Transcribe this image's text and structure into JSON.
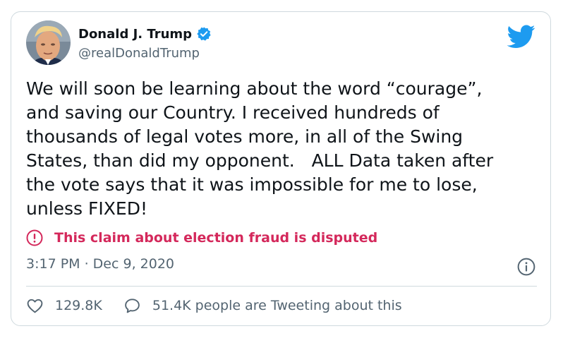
{
  "author": {
    "display_name": "Donald J. Trump",
    "handle": "@realDonaldTrump",
    "verified": true
  },
  "tweet": {
    "text": "We will soon be learning about the word “courage”,\nand saving our Country. I received hundreds of\nthousands of legal votes more, in all of the Swing\nStates, than did my opponent.   ALL Data taken after\nthe vote says that it was impossible for me to lose,\nunless FIXED!",
    "label": "This claim about election fraud is disputed",
    "timestamp": "3:17 PM · Dec 9, 2020"
  },
  "engagement": {
    "likes": "129.8K",
    "conversation": "51.4K people are Tweeting about this"
  },
  "icons": [
    "verified-badge-icon",
    "twitter-bird-icon",
    "disputed-label-icon",
    "info-icon",
    "heart-icon",
    "reply-bubble-icon"
  ],
  "colors": {
    "brand_blue": "#1d9bf0",
    "label_red": "#d4285b",
    "secondary_text": "#536471",
    "border": "#cfd9de"
  }
}
